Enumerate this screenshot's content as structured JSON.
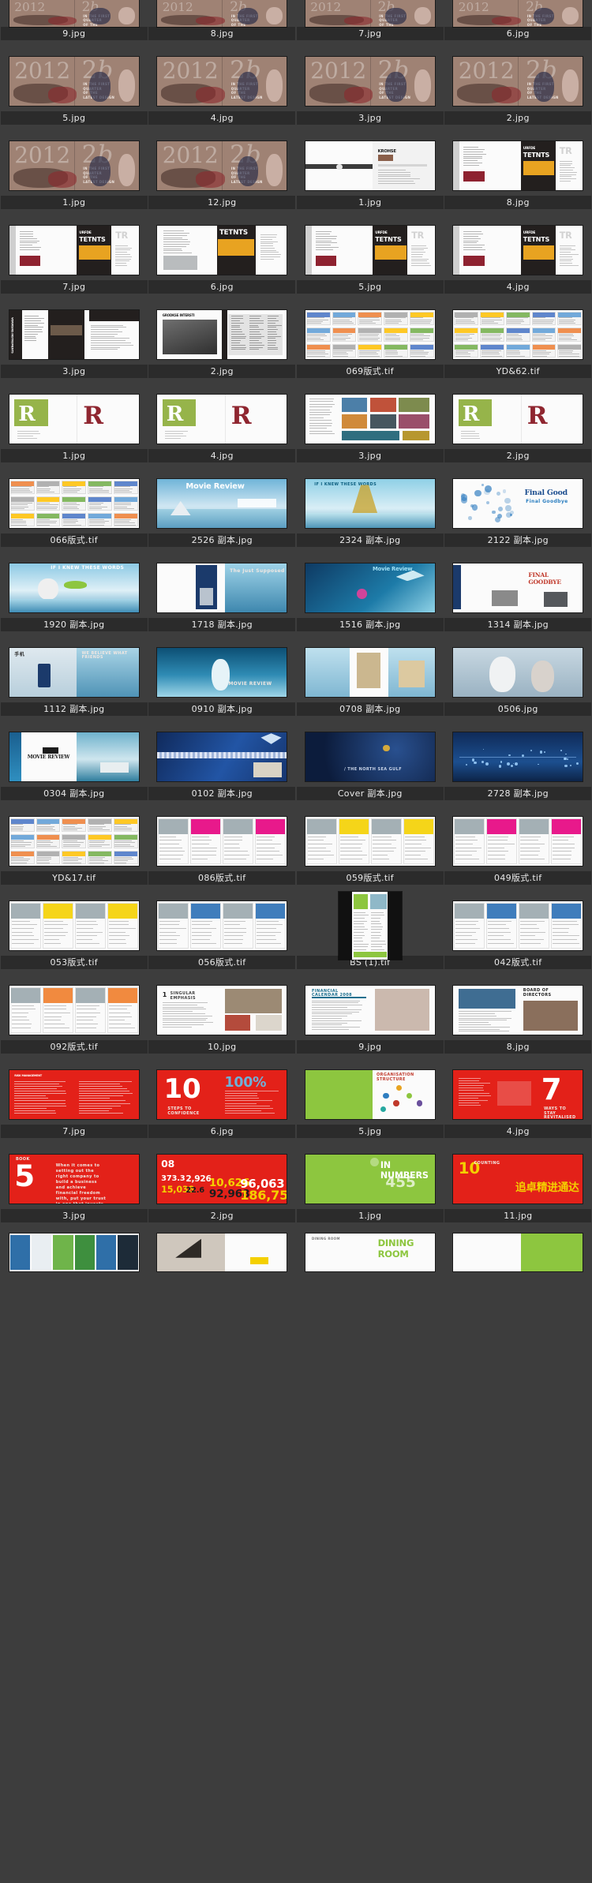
{
  "app": {
    "view": "thumbnail-grid",
    "columns": 4,
    "background_color": "#3d3d3d",
    "label_background_color": "#2b2b2b",
    "label_text_color": "#e9e9e9"
  },
  "rows": [
    {
      "index": 0,
      "partial": true,
      "files": [
        {
          "name": "9.jpg",
          "kind": "lingerie-campaign-spread"
        },
        {
          "name": "8.jpg",
          "kind": "lingerie-campaign-spread"
        },
        {
          "name": "7.jpg",
          "kind": "lingerie-campaign-spread"
        },
        {
          "name": "6.jpg",
          "kind": "lingerie-campaign-spread"
        }
      ]
    },
    {
      "index": 1,
      "files": [
        {
          "name": "5.jpg",
          "kind": "lingerie-campaign-spread"
        },
        {
          "name": "4.jpg",
          "kind": "lingerie-campaign-spread"
        },
        {
          "name": "3.jpg",
          "kind": "lingerie-campaign-spread"
        },
        {
          "name": "2.jpg",
          "kind": "lingerie-campaign-spread"
        }
      ]
    },
    {
      "index": 2,
      "files": [
        {
          "name": "1.jpg",
          "kind": "lingerie-campaign-spread"
        },
        {
          "name": "12.jpg",
          "kind": "lingerie-campaign-spread"
        },
        {
          "name": "1.jpg",
          "kind": "brochure-white-spread"
        },
        {
          "name": "8.jpg",
          "kind": "brochure-interior-spread"
        }
      ]
    },
    {
      "index": 3,
      "files": [
        {
          "name": "7.jpg",
          "kind": "brochure-interior-spread"
        },
        {
          "name": "6.jpg",
          "kind": "brochure-furniture-spread"
        },
        {
          "name": "5.jpg",
          "kind": "brochure-interior-spread"
        },
        {
          "name": "4.jpg",
          "kind": "brochure-interior-spread"
        }
      ]
    },
    {
      "index": 4,
      "files": [
        {
          "name": "3.jpg",
          "kind": "brochure-dark-spread"
        },
        {
          "name": "2.jpg",
          "kind": "brochure-bw-spread"
        },
        {
          "name": "069版式.tif",
          "kind": "layout-multipage-sheet"
        },
        {
          "name": "YD&62.tif",
          "kind": "layout-multipage-sheet"
        }
      ]
    },
    {
      "index": 5,
      "files": [
        {
          "name": "1.jpg",
          "kind": "logo-identity-spread"
        },
        {
          "name": "4.jpg",
          "kind": "logo-identity-spread"
        },
        {
          "name": "3.jpg",
          "kind": "photo-collage-spread"
        },
        {
          "name": "2.jpg",
          "kind": "logo-identity-spread"
        }
      ]
    },
    {
      "index": 6,
      "files": [
        {
          "name": "066版式.tif",
          "kind": "layout-multipage-sheet"
        },
        {
          "name": "2526 副本.jpg",
          "kind": "movie-review-cover"
        },
        {
          "name": "2324 副本.jpg",
          "kind": "movie-review-harp"
        },
        {
          "name": "2122 副本.jpg",
          "kind": "final-good-cover"
        }
      ]
    },
    {
      "index": 7,
      "files": [
        {
          "name": "1920 副本.jpg",
          "kind": "movie-review-violin"
        },
        {
          "name": "1718 副本.jpg",
          "kind": "movie-review-statue"
        },
        {
          "name": "1516 副本.jpg",
          "kind": "movie-review-gull"
        },
        {
          "name": "1314 副本.jpg",
          "kind": "final-goodbye-spread"
        }
      ]
    },
    {
      "index": 8,
      "files": [
        {
          "name": "1112 副本.jpg",
          "kind": "mobile-phone-ad"
        },
        {
          "name": "0910 副本.jpg",
          "kind": "bride-sea-spread"
        },
        {
          "name": "0708 副本.jpg",
          "kind": "statue-blue-spread"
        },
        {
          "name": "0506.jpg",
          "kind": "bride-sky-spread"
        }
      ]
    },
    {
      "index": 9,
      "files": [
        {
          "name": "0304 副本.jpg",
          "kind": "movie-review-piano"
        },
        {
          "name": "0102 副本.jpg",
          "kind": "blue-diamond-banner"
        },
        {
          "name": "Cover 副本.jpg",
          "kind": "dark-blue-cover"
        },
        {
          "name": "2728 副本.jpg",
          "kind": "blue-network-spread"
        }
      ]
    },
    {
      "index": 10,
      "files": [
        {
          "name": "YD&17.tif",
          "kind": "layout-multipage-sheet"
        },
        {
          "name": "086版式.tif",
          "kind": "layout-magenta-sheet"
        },
        {
          "name": "059版式.tif",
          "kind": "layout-yellow-sheet"
        },
        {
          "name": "049版式.tif",
          "kind": "layout-magenta-sheet"
        }
      ]
    },
    {
      "index": 11,
      "files": [
        {
          "name": "053版式.tif",
          "kind": "layout-yellow-sheet"
        },
        {
          "name": "056版式.tif",
          "kind": "layout-blue-sheet"
        },
        {
          "name": "BS (1).tif",
          "kind": "layout-green-portrait-sheet"
        },
        {
          "name": "042版式.tif",
          "kind": "layout-blue-sheet"
        }
      ]
    },
    {
      "index": 12,
      "files": [
        {
          "name": "092版式.tif",
          "kind": "layout-color-strip-sheet"
        },
        {
          "name": "10.jpg",
          "kind": "annual-report-spread"
        },
        {
          "name": "9.jpg",
          "kind": "financial-calendar-spread"
        },
        {
          "name": "8.jpg",
          "kind": "board-directors-spread"
        }
      ]
    },
    {
      "index": 13,
      "files": [
        {
          "name": "7.jpg",
          "kind": "red-report-spread"
        },
        {
          "name": "6.jpg",
          "kind": "red-ten-spread"
        },
        {
          "name": "5.jpg",
          "kind": "green-org-chart-spread"
        },
        {
          "name": "4.jpg",
          "kind": "red-seven-spread"
        }
      ]
    },
    {
      "index": 14,
      "files": [
        {
          "name": "3.jpg",
          "kind": "red-five-spread"
        },
        {
          "name": "2.jpg",
          "kind": "red-numbers-spread"
        },
        {
          "name": "1.jpg",
          "kind": "green-numbers-spread"
        },
        {
          "name": "11.jpg",
          "kind": "red-chinese-spread"
        }
      ]
    },
    {
      "index": 15,
      "partial": true,
      "files": [
        {
          "name": "",
          "kind": "web-layout-strip"
        },
        {
          "name": "",
          "kind": "interior-stairs-spread"
        },
        {
          "name": "",
          "kind": "dining-room-spread"
        },
        {
          "name": "",
          "kind": "green-layout-spread"
        }
      ]
    }
  ]
}
